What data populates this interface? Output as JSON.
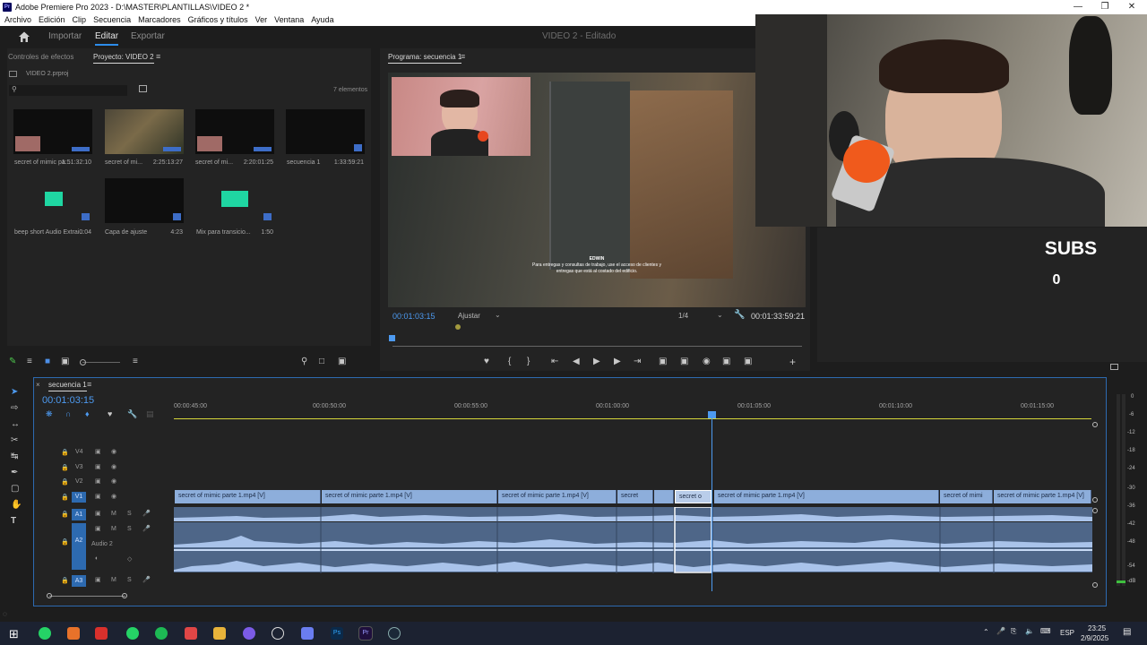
{
  "window": {
    "title": "Adobe Premiere Pro 2023 - D:\\MASTER\\PLANTILLAS\\VIDEO 2 *",
    "app_icon_text": "Pr"
  },
  "menu": [
    "Archivo",
    "Edición",
    "Clip",
    "Secuencia",
    "Marcadores",
    "Gráficos y títulos",
    "Ver",
    "Ventana",
    "Ayuda"
  ],
  "workspace": {
    "tabs": [
      "Importar",
      "Editar",
      "Exportar"
    ],
    "active_tab": "Editar",
    "document": "VIDEO 2 - Editado"
  },
  "project_panel": {
    "tabs": [
      "Controles de efectos",
      "Proyecto: VIDEO 2"
    ],
    "project_file": "VIDEO 2.prproj",
    "item_count": "7 elementos",
    "items": [
      {
        "name": "secret of mimic pa...",
        "duration": "1:51:32:10"
      },
      {
        "name": "secret of mi...",
        "duration": "2:25:13:27"
      },
      {
        "name": "secret of mi...",
        "duration": "2:20:01:25"
      },
      {
        "name": "secuencia 1",
        "duration": "1:33:59:21"
      },
      {
        "name": "beep short Audio Extrai...",
        "duration": "0:04"
      },
      {
        "name": "Capa de ajuste",
        "duration": "4:23"
      },
      {
        "name": "Mix para transicio...",
        "duration": "1:50"
      }
    ]
  },
  "program_monitor": {
    "tab": "Programa: secuencia 1",
    "timecode": "00:01:03:15",
    "fit": "Ajustar",
    "resolution": "1/4",
    "duration": "00:01:33:59:21",
    "subtitle_name": "EDWIN",
    "subtitle_line1": "Para entregas y consultas de trabajo, use el acceso de clientes y",
    "subtitle_line2": "entregas que está al costado del edificio."
  },
  "timeline": {
    "tab": "secuencia 1",
    "timecode": "00:01:03:15",
    "ruler": [
      "00:00:45:00",
      "00:00:50:00",
      "00:00:55:00",
      "00:01:00:00",
      "00:01:05:00",
      "00:01:10:00",
      "00:01:15:00"
    ],
    "tracks_video": [
      "V4",
      "V3",
      "V2",
      "V1"
    ],
    "tracks_audio": [
      "A1",
      "A2",
      "A3"
    ],
    "audio2_name": "Audio 2",
    "audio_track_flags": [
      "M",
      "S"
    ],
    "clips_v1": [
      "secret of mimic parte 1.mp4 [V]",
      "secret of mimic parte 1.mp4 [V]",
      "secret of mimic parte 1.mp4 [V]",
      "secret",
      "secret o",
      "secret of mimic parte 1.mp4 [V]",
      "secret of mimi",
      "secret of mimic parte 1.mp4 [V]"
    ],
    "meter_db": [
      "0",
      "-6",
      "-12",
      "-18",
      "-24",
      "-30",
      "-36",
      "-42",
      "-48",
      "-54",
      "-dB"
    ]
  },
  "overlay": {
    "subs_label": "SUBS",
    "subs_count": "0"
  },
  "taskbar": {
    "time": "23:25",
    "date": "2/9/2025",
    "lang": "ESP"
  }
}
